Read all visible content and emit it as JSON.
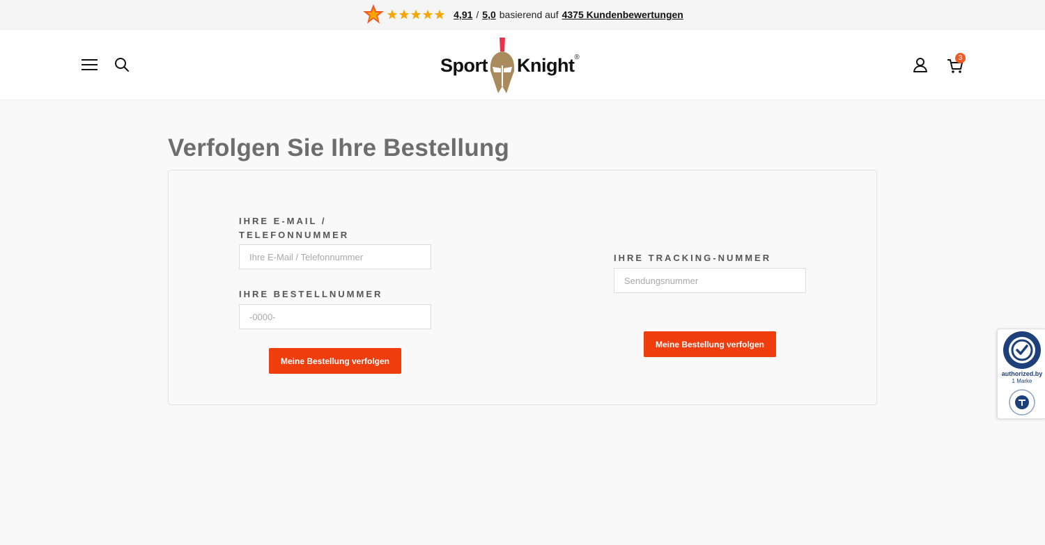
{
  "announcement": {
    "rating": "4,91",
    "separator": "/",
    "max_rating": "5,0",
    "middle_text": "basierend auf",
    "reviews_link": "4375 Kundenbewertungen"
  },
  "header": {
    "logo_left": "Sport",
    "logo_right": "Knight",
    "logo_reg": "®",
    "cart_count": "3"
  },
  "page": {
    "title": "Verfolgen Sie Ihre Bestellung"
  },
  "form_order": {
    "email_label": "IHRE E-MAIL / TELEFONNUMMER",
    "email_placeholder": "Ihre E-Mail / Telefonnummer",
    "order_label": "IHRE BESTELLNUMMER",
    "order_placeholder": "-0000-",
    "button": "Meine Bestellung verfolgen"
  },
  "form_tracking": {
    "tracking_label": "IHRE TRACKING-NUMMER",
    "tracking_placeholder": "Sendungsnummer",
    "button": "Meine Bestellung verfolgen"
  },
  "trust_badge": {
    "line1": "authorized.by",
    "line2": "1 Marke"
  },
  "colors": {
    "accent": "#ef3d0e",
    "star": "#f7a600",
    "title_gray": "#6d6d6d"
  }
}
